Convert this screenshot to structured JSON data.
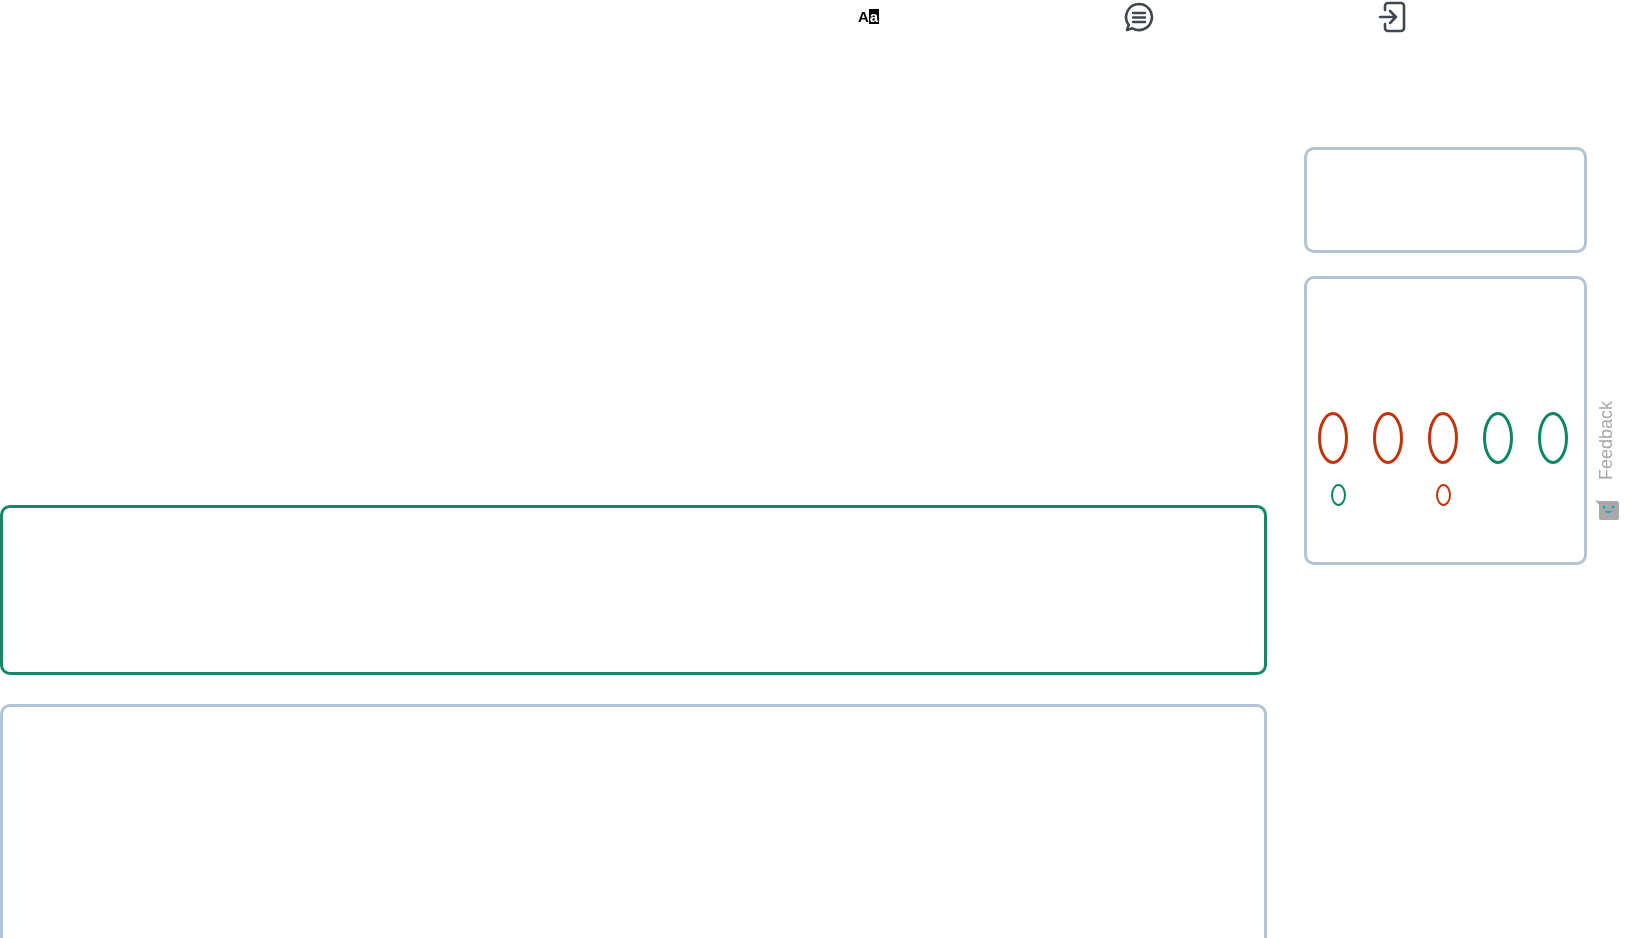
{
  "toolbar": {
    "font_button": {
      "letters": [
        "A",
        "a"
      ]
    }
  },
  "score_card": {
    "rings": [
      {
        "kind": "large",
        "color": "#c0350c"
      },
      {
        "kind": "large",
        "color": "#c0350c"
      },
      {
        "kind": "large",
        "color": "#c0350c"
      },
      {
        "kind": "large",
        "color": "#0a8766"
      },
      {
        "kind": "large",
        "color": "#0a8766"
      },
      {
        "kind": "small",
        "color": "#0a8766"
      },
      {
        "kind": "small",
        "color": "#c0350c"
      }
    ]
  },
  "feedback": {
    "label": "Feedback"
  }
}
